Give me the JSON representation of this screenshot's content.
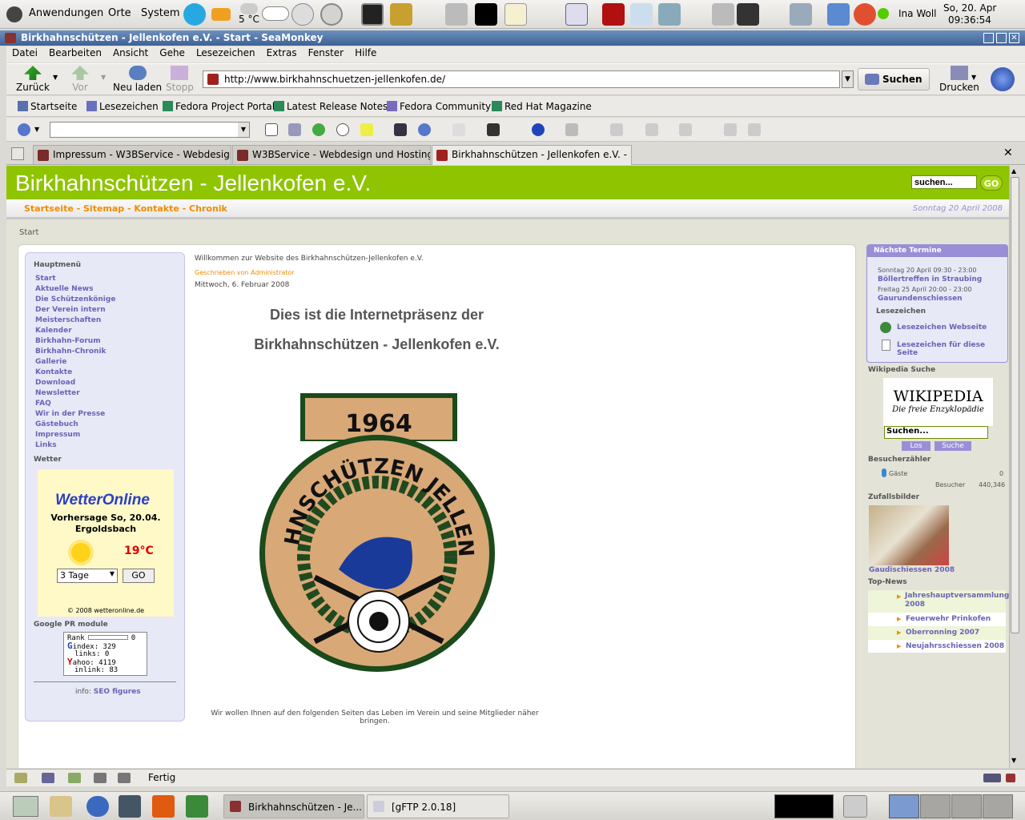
{
  "panel": {
    "menus": [
      "Anwendungen",
      "Orte",
      "System"
    ],
    "temperature": "5 °C",
    "user": "Ina Woll",
    "date": "So, 20. Apr",
    "time": "09:36:54"
  },
  "window": {
    "title": "Birkhahnschützen - Jellenkofen e.V. - Start - SeaMonkey"
  },
  "menubar": [
    "Datei",
    "Bearbeiten",
    "Ansicht",
    "Gehe",
    "Lesezeichen",
    "Extras",
    "Fenster",
    "Hilfe"
  ],
  "navbar": {
    "back": "Zurück",
    "forward": "Vor",
    "reload": "Neu laden",
    "stop": "Stopp",
    "url": "http://www.birkhahnschuetzen-jellenkofen.de/",
    "search": "Suchen",
    "print": "Drucken"
  },
  "bookmarks": [
    "Startseite",
    "Lesezeichen",
    "Fedora Project Portal",
    "Latest Release Notes",
    "Fedora Community",
    "Red Hat Magazine"
  ],
  "tabs": [
    {
      "label": "Impressum - W3BService - Webdesign ..."
    },
    {
      "label": "W3BService - Webdesign und Hosting -..."
    },
    {
      "label": "Birkhahnschützen - Jellenkofen e.V. - ..."
    }
  ],
  "site": {
    "title": "Birkhahnschützen - Jellenkofen e.V.",
    "search_placeholder": "suchen...",
    "go": "GO",
    "nav": "Startseite -  Sitemap -  Kontakte -  Chronik",
    "date": "Sonntag 20 April 2008",
    "breadcrumb": "Start",
    "menu_heading": "Hauptmenü",
    "menu": [
      "Start",
      "Aktuelle News",
      "Die Schützenkönige",
      "Der Verein intern",
      "Meisterschaften",
      "Kalender",
      "Birkhahn-Forum",
      "Birkhahn-Chronik",
      "Gallerie",
      "Kontakte",
      "Download",
      "Newsletter",
      "FAQ",
      "Wir in der Presse",
      "Gästebuch",
      "Impressum",
      "Links"
    ],
    "weather_heading": "Wetter",
    "weather": {
      "logo": "WetterOnline",
      "line1": "Vorhersage So, 20.04.",
      "line2": "Ergoldsbach",
      "temp": "19°C",
      "select": "3 Tage",
      "go": "GO",
      "copyright": "© 2008 wetteronline.de"
    },
    "pr_heading": "Google PR module",
    "pr": {
      "rank": "Rank",
      "rank_val": "0",
      "gindex": "index: 329",
      "glinks": "links: 0",
      "yahoo": "ahoo: 4119",
      "ylinks": "inlink: 83"
    },
    "seo_prefix": "info:",
    "seo_link": "SEO figures",
    "welcome": "Willkommen zur Website des Birkhahnschützen-Jellenkofen e.V.",
    "author": "Geschrieben von Administrator",
    "article_date": "Mittwoch, 6. Februar 2008",
    "heading1": "Dies ist die Internetpräsenz der",
    "heading2": "Birkhahnschützen - Jellenkofen e.V.",
    "logo_year": "1964",
    "logo_text": "BIRKHAHNSCHÜTZEN JELLENKOFEN",
    "footer_text": "Wir wollen Ihnen auf den folgenden Seiten das Leben im Verein und seine Mitglieder näher bringen.",
    "right": {
      "termine_heading": "Nächste Termine",
      "event1_date": "Sonntag 20 April 09:30 - 23:00",
      "event1": "Böllertreffen in Straubing",
      "event2_date": "Freitag 25 April 20:00 - 23:00",
      "event2": "Gaurundenschiessen",
      "lesezeichen_heading": "Lesezeichen",
      "lz1": "Lesezeichen Webseite",
      "lz2": "Lesezeichen für diese Seite",
      "wiki_heading": "Wikipedia Suche",
      "wiki_logo": "WIKIPEDIA",
      "wiki_sub": "Die freie Enzyklopädie",
      "wiki_input": "Suchen...",
      "wiki_los": "Los",
      "wiki_suche": "Suche",
      "counter_heading": "Besucherzähler",
      "guests_label": "Gäste",
      "guests": "0",
      "visitors_label": "Besucher",
      "visitors": "440,346",
      "random_heading": "Zufallsbilder",
      "random_caption": "Gaudischiessen 2008",
      "topnews_heading": "Top-News",
      "topnews": [
        "Jahreshauptversammlung 2008",
        "Feuerwehr Prinkofen",
        "Oberronning 2007",
        "Neujahrsschiessen 2008"
      ]
    }
  },
  "status": "Fertig",
  "taskbar": [
    {
      "label": "Birkhahnschützen - Je..."
    },
    {
      "label": "[gFTP 2.0.18]"
    }
  ]
}
